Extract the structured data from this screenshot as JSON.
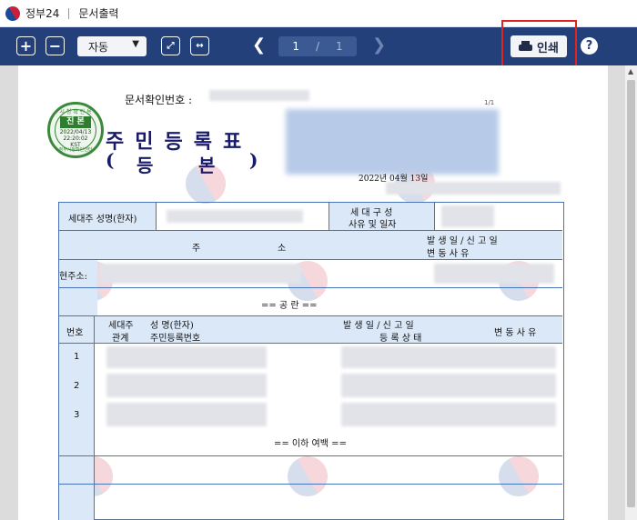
{
  "titlebar": {
    "app_name": "정부24",
    "section": "문서출력"
  },
  "toolbar": {
    "zoom_in_label": "+",
    "zoom_out_label": "−",
    "zoom_value": "자동",
    "page_current": "1",
    "page_separator": "/",
    "page_total": "1",
    "print_label": "인쇄",
    "help_label": "?"
  },
  "seal": {
    "top": "시 청 확 인 용",
    "main": "진 본",
    "date_line1": "2022/04/13",
    "date_line2": "22:20:02",
    "date_line3": "KST",
    "bottom": "정부시청확인센터"
  },
  "document": {
    "confirm_label": "문서확인번호 :",
    "page_counter": "1/1",
    "title": "주민등록표",
    "subtitle_open": "(",
    "subtitle_word1": "등",
    "subtitle_word2": "본",
    "subtitle_close": ")",
    "date_prefix": "2022년 04월 13일",
    "head_name_label": "세대주 성명(한자)",
    "household_label_1": "세 대 구 성",
    "household_label_2": "사유 및 일자",
    "address_label": "주",
    "address_label_2": "소",
    "report_date_label": "발 생 일 / 신 고 일",
    "change_reason_label": "변      동      사      유",
    "current_address_label": "현주소:",
    "blank_marker": "== 공        란 ==",
    "col_number": "번호",
    "col_relation_1": "세대주",
    "col_relation_2": "관계",
    "col_name": "성 명(한자)",
    "col_id": "주민등록번호",
    "col_dates": "발 생 일 / 신 고 일",
    "col_status": "등 록 상 태",
    "col_change": "변 동 사 유",
    "rows": [
      "1",
      "2",
      "3"
    ],
    "end_marker": "== 이하 여백 =="
  }
}
